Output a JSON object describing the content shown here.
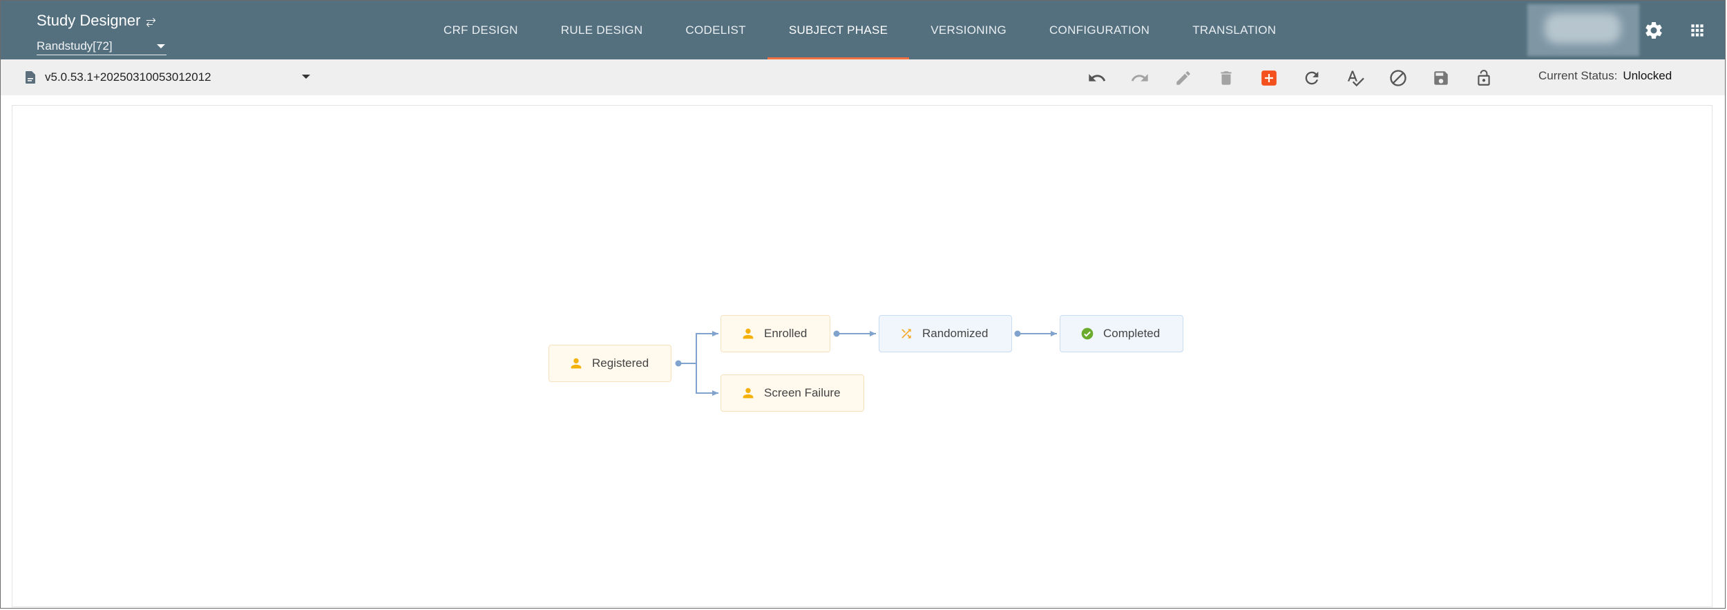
{
  "header": {
    "app_title": "Study Designer",
    "study_selector": "Randstudy[72]",
    "tabs": [
      {
        "label": "CRF DESIGN",
        "active": false
      },
      {
        "label": "RULE DESIGN",
        "active": false
      },
      {
        "label": "CODELIST",
        "active": false
      },
      {
        "label": "SUBJECT PHASE",
        "active": true
      },
      {
        "label": "VERSIONING",
        "active": false
      },
      {
        "label": "CONFIGURATION",
        "active": false
      },
      {
        "label": "TRANSLATION",
        "active": false
      }
    ],
    "icons": [
      "swap-icon",
      "settings-gear-icon",
      "apps-grid-icon"
    ]
  },
  "toolbar": {
    "version": "v5.0.53.1+20250310053012012",
    "buttons": [
      "undo",
      "redo",
      "edit",
      "delete",
      "add",
      "refresh",
      "spellcheck",
      "block",
      "save",
      "lock-open"
    ],
    "status_label": "Current Status:",
    "status_value": "Unlocked"
  },
  "flow": {
    "nodes": [
      {
        "label": "Registered",
        "icon": "person-icon",
        "kind": "subject"
      },
      {
        "label": "Enrolled",
        "icon": "person-icon",
        "kind": "subject"
      },
      {
        "label": "Screen Failure",
        "icon": "person-icon",
        "kind": "subject"
      },
      {
        "label": "Randomized",
        "icon": "shuffle-icon",
        "kind": "randomization"
      },
      {
        "label": "Completed",
        "icon": "check-circle-icon",
        "kind": "completion"
      }
    ],
    "edges": [
      [
        "Registered",
        "Enrolled"
      ],
      [
        "Registered",
        "Screen Failure"
      ],
      [
        "Enrolled",
        "Randomized"
      ],
      [
        "Randomized",
        "Completed"
      ]
    ]
  },
  "colors": {
    "header_bg": "#54707f",
    "active_tab_underline": "#f26f3f",
    "toolbar_bg": "#efefef",
    "add_button": "#f4511e",
    "subject_icon": "#f5b10b",
    "completed_icon": "#6aab2e",
    "edge": "#7fa3cc"
  }
}
